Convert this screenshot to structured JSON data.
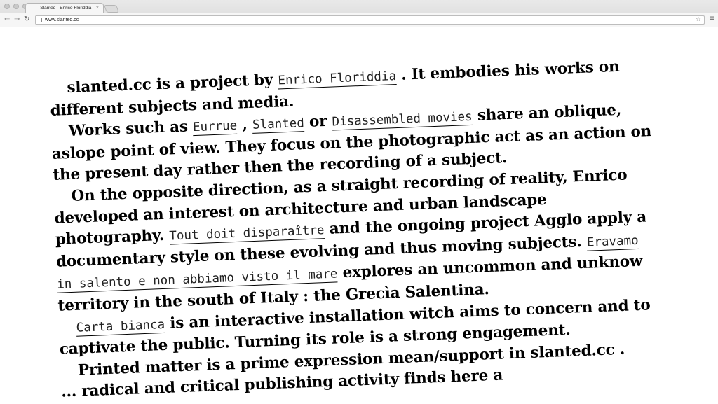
{
  "browser": {
    "tab_title": "— Slanted - Enrico Floriddia",
    "tab_close": "×",
    "url": "www.slanted.cc",
    "back_icon": "back-arrow-icon",
    "forward_icon": "forward-arrow-icon",
    "reload_icon": "reload-icon"
  },
  "content": {
    "p1": {
      "t1": "slanted.cc is a project by ",
      "link1": "Enrico Floriddia",
      "t2": " . It embodies his works on different subjects and media."
    },
    "p2": {
      "t1": "Works such as ",
      "link1": "Eurrue",
      "t2": " , ",
      "link2": "Slanted",
      "t3": " or ",
      "link3": "Disassembled movies",
      "t4": " share an oblique, aslope point of view. They focus on the photographic act as an action on the present day rather then the recording of a subject."
    },
    "p3": {
      "t1": "On the opposite direction, as a straight recording of reality, Enrico developed an interest on architecture and urban landscape photography. ",
      "link1": "Tout doit disparaître",
      "t2": " and the ongoing project Agglo apply a documentary style on these evolving and thus moving subjects. ",
      "link2": "Eravamo in salento e non abbiamo visto il mare",
      "t3": " explores an uncommon and unknow territory in the south of Italy : the Grecìa Salentina."
    },
    "p4": {
      "link1": "Carta bianca",
      "t1": " is an interactive installation witch aims to concern and to captivate the public. Turning its role is a strong engagement."
    },
    "p5": {
      "t1": "Printed matter is a prime expression mean/support in slanted.cc .",
      "t2": "... radical and critical publishing activity finds here a"
    }
  }
}
